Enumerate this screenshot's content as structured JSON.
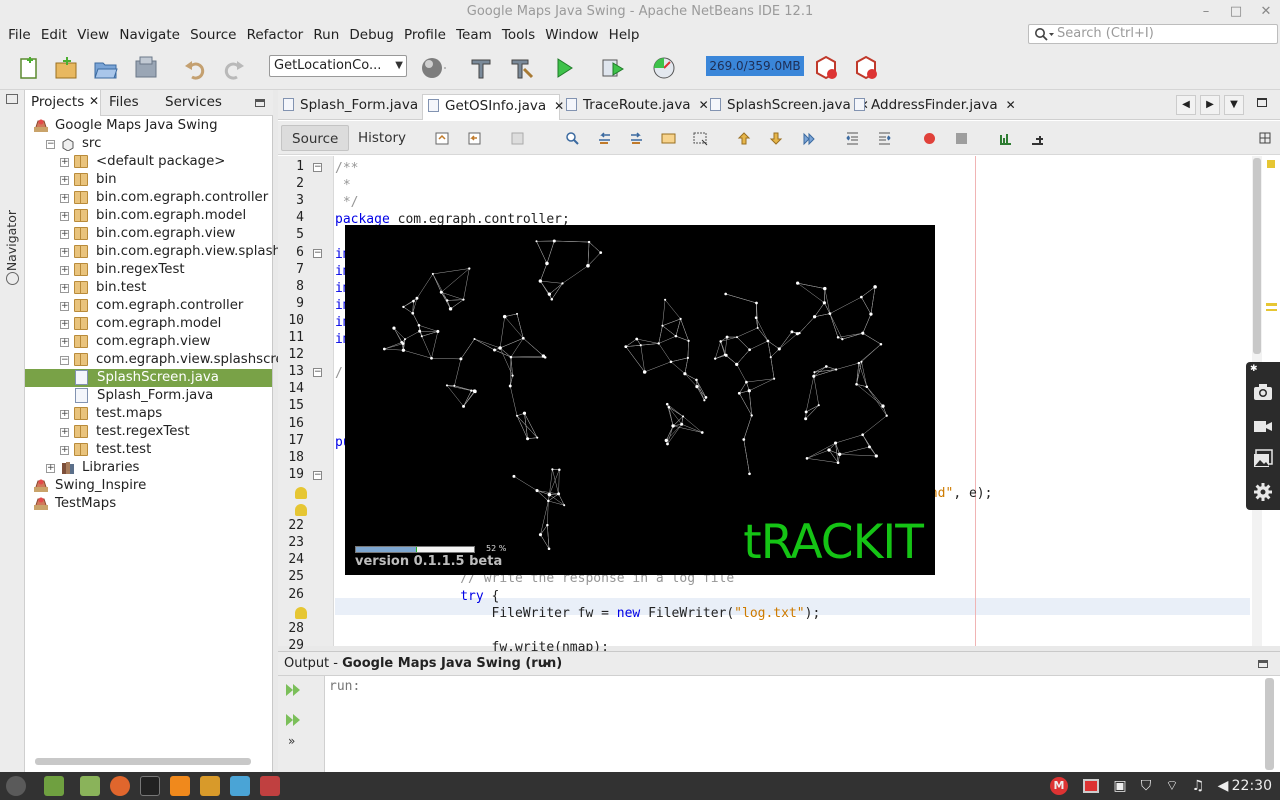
{
  "window": {
    "title": "Google Maps Java Swing - Apache NetBeans IDE 12.1",
    "controls": {
      "minimize": "–",
      "maximize": "□",
      "close": "✕"
    }
  },
  "menu": [
    "File",
    "Edit",
    "View",
    "Navigate",
    "Source",
    "Refactor",
    "Run",
    "Debug",
    "Profile",
    "Team",
    "Tools",
    "Window",
    "Help"
  ],
  "search": {
    "placeholder": "Search (Ctrl+I)"
  },
  "toolbar": {
    "config_value": "GetLocationCo...",
    "memory": "269.0/359.0MB",
    "icons": [
      "new-file-icon",
      "new-project-icon",
      "open-project-icon",
      "close-project-icon",
      "undo-icon",
      "redo-icon",
      "globe-icon",
      "build-icon",
      "clean-build-icon",
      "run-icon",
      "debug-icon",
      "profile-icon",
      "gc-icon",
      "profiler-snapshot-icon"
    ]
  },
  "navigator": {
    "label": "Navigator"
  },
  "projects_panel": {
    "tabs": [
      "Projects",
      "Files",
      "Services"
    ],
    "tree": [
      {
        "label": "Google Maps Java Swing",
        "type": "project",
        "indent": 0,
        "exp": ""
      },
      {
        "label": "src",
        "type": "srcroot",
        "indent": 1,
        "exp": "−"
      },
      {
        "label": "<default package>",
        "type": "pkg",
        "indent": 2,
        "exp": "+"
      },
      {
        "label": "bin",
        "type": "pkg",
        "indent": 2,
        "exp": "+"
      },
      {
        "label": "bin.com.egraph.controller",
        "type": "pkg",
        "indent": 2,
        "exp": "+"
      },
      {
        "label": "bin.com.egraph.model",
        "type": "pkg",
        "indent": 2,
        "exp": "+"
      },
      {
        "label": "bin.com.egraph.view",
        "type": "pkg",
        "indent": 2,
        "exp": "+"
      },
      {
        "label": "bin.com.egraph.view.splashscre",
        "type": "pkg",
        "indent": 2,
        "exp": "+"
      },
      {
        "label": "bin.regexTest",
        "type": "pkg",
        "indent": 2,
        "exp": "+"
      },
      {
        "label": "bin.test",
        "type": "pkg",
        "indent": 2,
        "exp": "+"
      },
      {
        "label": "com.egraph.controller",
        "type": "pkg",
        "indent": 2,
        "exp": "+"
      },
      {
        "label": "com.egraph.model",
        "type": "pkg",
        "indent": 2,
        "exp": "+"
      },
      {
        "label": "com.egraph.view",
        "type": "pkg",
        "indent": 2,
        "exp": "+"
      },
      {
        "label": "com.egraph.view.splashscreen",
        "type": "pkg",
        "indent": 2,
        "exp": "−"
      },
      {
        "label": "SplashScreen.java",
        "type": "java",
        "indent": 3,
        "exp": "",
        "selected": true
      },
      {
        "label": "Splash_Form.java",
        "type": "java",
        "indent": 3,
        "exp": ""
      },
      {
        "label": "test.maps",
        "type": "pkg",
        "indent": 2,
        "exp": "+"
      },
      {
        "label": "test.regexTest",
        "type": "pkg",
        "indent": 2,
        "exp": "+"
      },
      {
        "label": "test.test",
        "type": "pkg",
        "indent": 2,
        "exp": "+"
      },
      {
        "label": "Libraries",
        "type": "lib",
        "indent": 1,
        "exp": "+"
      },
      {
        "label": "Swing_Inspire",
        "type": "project",
        "indent": 0,
        "exp": ""
      },
      {
        "label": "TestMaps",
        "type": "project",
        "indent": 0,
        "exp": ""
      }
    ]
  },
  "editor": {
    "tabs": [
      {
        "label": "Splash_Form.java",
        "active": false
      },
      {
        "label": "GetOSInfo.java",
        "active": true
      },
      {
        "label": "TraceRoute.java",
        "active": false
      },
      {
        "label": "SplashScreen.java",
        "active": false
      },
      {
        "label": "AddressFinder.java",
        "active": false
      }
    ],
    "view_buttons": [
      "Source",
      "History"
    ],
    "lines": [
      {
        "n": "1",
        "html": "<span class='cm'>/**</span>"
      },
      {
        "n": "2",
        "html": "<span class='cm'> *</span>"
      },
      {
        "n": "3",
        "html": "<span class='cm'> */</span>"
      },
      {
        "n": "4",
        "html": "<span class='kw'>package</span> com.egraph.controller;"
      },
      {
        "n": "5",
        "html": ""
      },
      {
        "n": "6",
        "html": "<span class='kw'>im</span>"
      },
      {
        "n": "7",
        "html": "<span class='kw'>im</span>"
      },
      {
        "n": "8",
        "html": "<span class='kw'>im</span>"
      },
      {
        "n": "9",
        "html": "<span class='kw'>im</span>"
      },
      {
        "n": "10",
        "html": "<span class='kw'>im</span>"
      },
      {
        "n": "11",
        "html": "<span class='kw'>im</span>"
      },
      {
        "n": "12",
        "html": ""
      },
      {
        "n": "13",
        "html": "<span class='cm'>/</span>"
      },
      {
        "n": "14",
        "html": ""
      },
      {
        "n": "15",
        "html": ""
      },
      {
        "n": "16",
        "html": ""
      },
      {
        "n": "17",
        "html": "<span class='kw'>pu</span>"
      },
      {
        "n": "18",
        "html": ""
      },
      {
        "n": "19",
        "html": ""
      },
      {
        "n": "",
        "html": "                                                  <span class='st'>rforming trace route command\"</span>, e);"
      },
      {
        "n": "",
        "html": ""
      },
      {
        "n": "22",
        "html": "                                                  ;"
      },
      {
        "n": "23",
        "html": ""
      },
      {
        "n": "24",
        "html": "                                                  ());"
      },
      {
        "n": "25",
        "html": "                <span class='cm'>// write the response in a log file</span>"
      },
      {
        "n": "26",
        "html": "                <span class='kw'>try</span> {"
      },
      {
        "n": "",
        "html": "                    FileWriter fw = <span class='kw'>new</span> FileWriter(<span class='st'>\"log.txt\"</span>);"
      },
      {
        "n": "28",
        "html": ""
      },
      {
        "n": "29",
        "html": "                    fw.write(nmap);"
      }
    ]
  },
  "splash": {
    "progress": 0.52,
    "progress_label": "52 %",
    "version": "version 0.1.1.5 beta",
    "brand": "tRACKIT"
  },
  "output": {
    "title_prefix": "Output - ",
    "title_bold": "Google Maps Java Swing (run)",
    "text": "run:"
  },
  "taskbar": {
    "clock": "22:30"
  },
  "colors": {
    "selection": "#79a247",
    "memory_bar": "#3a86d9",
    "splash_green": "#15c415"
  }
}
